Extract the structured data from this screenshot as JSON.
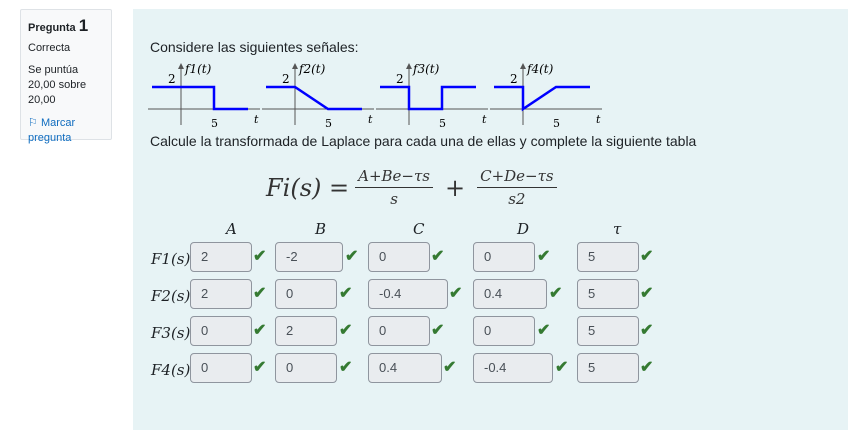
{
  "info": {
    "label": "Pregunta",
    "number": "1",
    "state": "Correcta",
    "grade": "Se puntúa 20,00 sobre 20,00",
    "flag": "Marcar pregunta"
  },
  "question": {
    "intro": "Considere las siguientes señales:",
    "instruction": "Calcule la transformada de Laplace para cada una de ellas y complete la siguiente tabla",
    "signals": [
      {
        "label": "f1(t)",
        "tick_y": "2",
        "tick_x": "5",
        "axis_t": "t"
      },
      {
        "label": "f2(t)",
        "tick_y": "2",
        "tick_x": "5",
        "axis_t": "t"
      },
      {
        "label": "f3(t)",
        "tick_y": "2",
        "tick_x": "5",
        "axis_t": "t"
      },
      {
        "label": "f4(t)",
        "tick_y": "2",
        "tick_x": "5",
        "axis_t": "t"
      }
    ],
    "formula": {
      "lhs": "Fi(s) =",
      "num1": "A+Be−τs",
      "den1": "s",
      "plus": "+",
      "num2": "C+De−τs",
      "den2": "s2"
    }
  },
  "table": {
    "columns": [
      "A",
      "B",
      "C",
      "D",
      "τ"
    ],
    "rows": [
      {
        "label": "F1(s)",
        "values": [
          "2",
          "-2",
          "0",
          "0",
          "5"
        ]
      },
      {
        "label": "F2(s)",
        "values": [
          "2",
          "0",
          "-0.4",
          "0.4",
          "5"
        ]
      },
      {
        "label": "F3(s)",
        "values": [
          "0",
          "2",
          "0",
          "0",
          "5"
        ]
      },
      {
        "label": "F4(s)",
        "values": [
          "0",
          "0",
          "0.4",
          "-0.4",
          "5"
        ]
      }
    ]
  },
  "colors": {
    "signal": "#0000ff",
    "correct": "#357a32",
    "flag": "#0f6cbf"
  }
}
